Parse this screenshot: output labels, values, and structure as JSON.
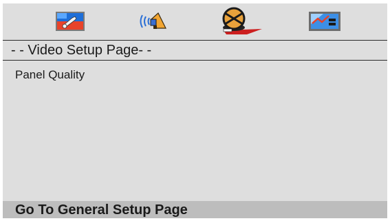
{
  "tabs": [
    {
      "icon": "general-setup-icon"
    },
    {
      "icon": "audio-setup-icon"
    },
    {
      "icon": "video-setup-icon",
      "selected": true
    },
    {
      "icon": "preference-setup-icon"
    }
  ],
  "page": {
    "title": "- - Video Setup Page- -"
  },
  "menu": {
    "items": [
      {
        "label": "Panel Quality"
      }
    ]
  },
  "footer": {
    "hint": "Go To General Setup Page"
  },
  "colors": {
    "background": "#dedede",
    "footer_background": "#bdbdbd",
    "selected_accent": "#cc1f1f"
  }
}
